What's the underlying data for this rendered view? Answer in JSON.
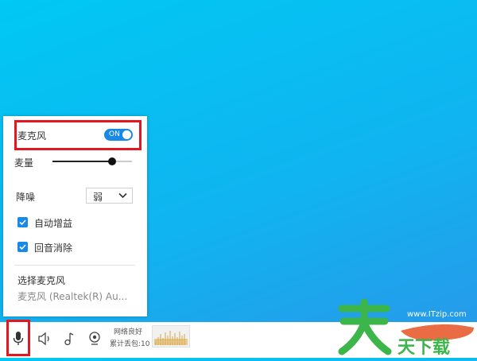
{
  "mic_panel": {
    "microphone_label": "麦克风",
    "toggle_label": "ON",
    "volume_label": "麦量",
    "volume_level": 0.75,
    "noise_label": "降噪",
    "noise_value": "弱",
    "auto_gain_label": "自动增益",
    "echo_cancel_label": "回音消除",
    "select_mic_label": "选择麦克风",
    "selected_device": "麦克风 (Realtek(R) Au..."
  },
  "taskbar": {
    "network_status": "网络良好",
    "packet_loss": "累计丢包:10"
  },
  "watermark": {
    "url": "www.ITzip.com",
    "text": "天下载"
  },
  "colors": {
    "accent": "#1989e8",
    "highlight": "#e3171f",
    "watermark_green": "#3cb54a",
    "watermark_orange": "#e8643a"
  }
}
